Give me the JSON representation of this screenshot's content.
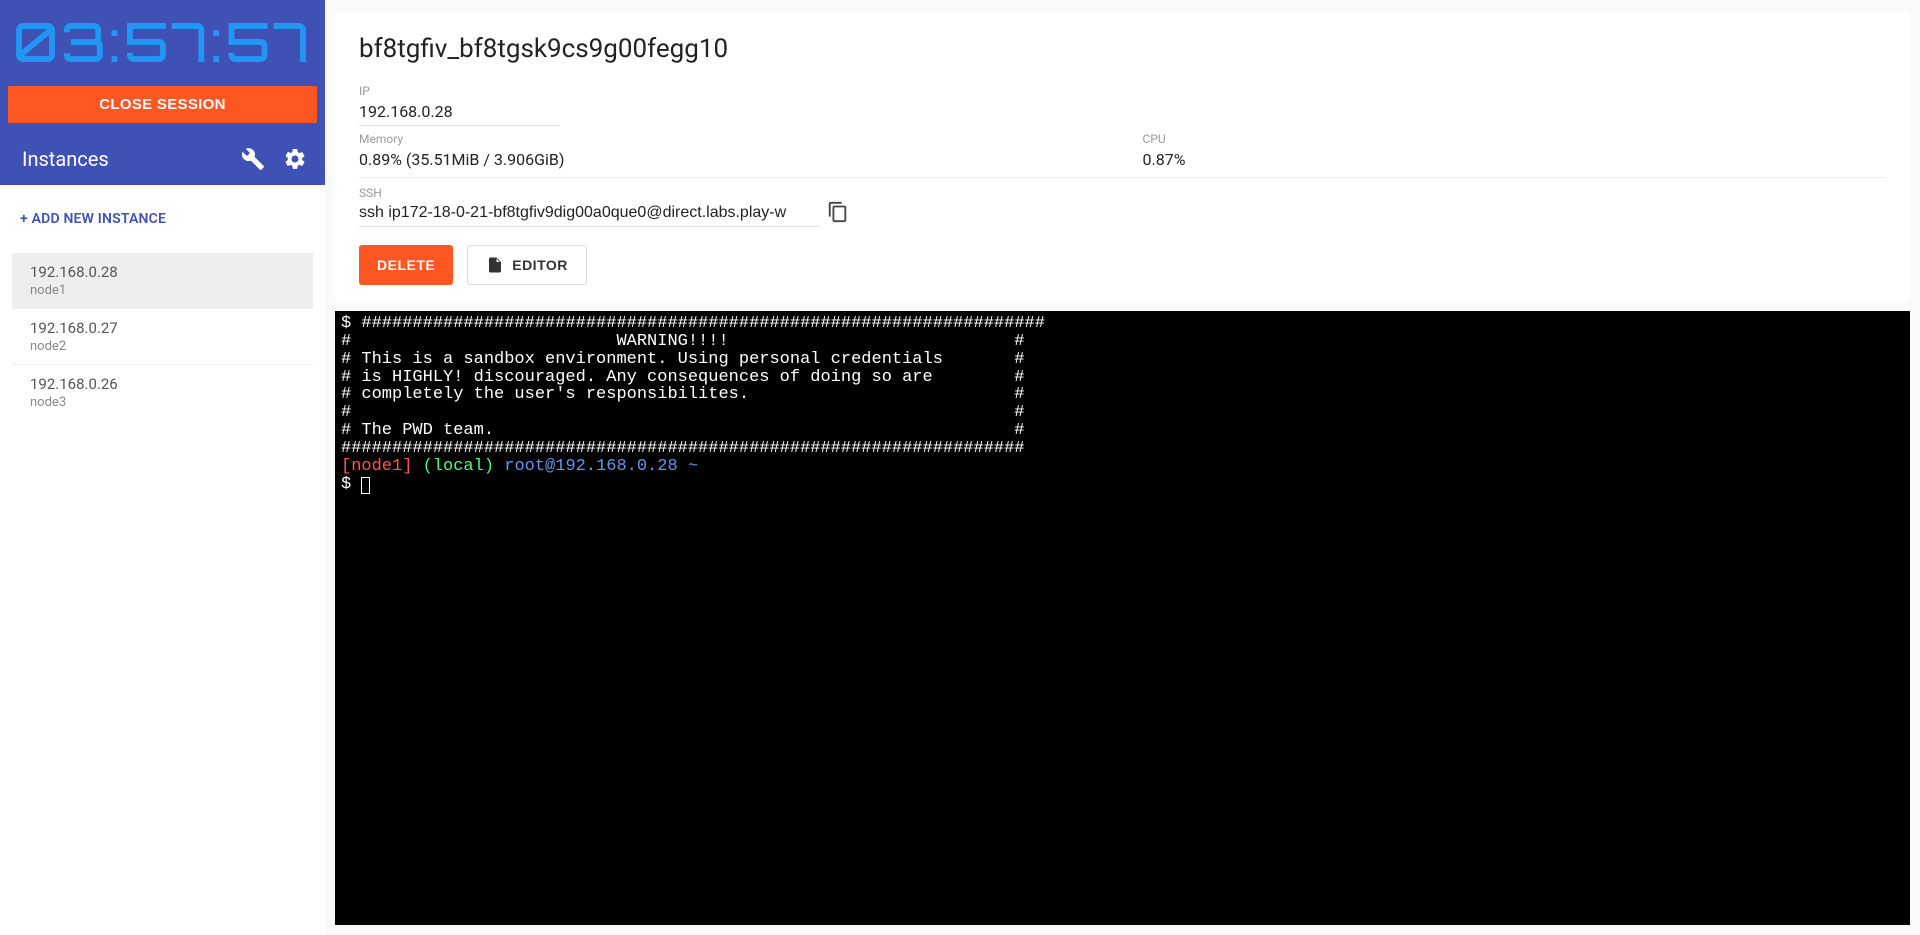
{
  "timer": "03:57:57",
  "close_session_label": "CLOSE SESSION",
  "sidebar": {
    "title": "Instances",
    "add_instance_label": "+ ADD NEW INSTANCE",
    "instances": [
      {
        "ip": "192.168.0.28",
        "name": "node1",
        "selected": true
      },
      {
        "ip": "192.168.0.27",
        "name": "node2",
        "selected": false
      },
      {
        "ip": "192.168.0.26",
        "name": "node3",
        "selected": false
      }
    ]
  },
  "details": {
    "title": "bf8tgfiv_bf8tgsk9cs9g00fegg10",
    "ip_label": "IP",
    "ip_value": "192.168.0.28",
    "memory_label": "Memory",
    "memory_value": "0.89% (35.51MiB / 3.906GiB)",
    "cpu_label": "CPU",
    "cpu_value": "0.87%",
    "ssh_label": "SSH",
    "ssh_value": "ssh ip172-18-0-21-bf8tgfiv9dig00a0que0@direct.labs.play-w",
    "delete_label": "DELETE",
    "editor_label": "EDITOR"
  },
  "terminal": {
    "lines": [
      {
        "segments": [
          {
            "t": "$ ",
            "c": "white"
          },
          {
            "t": "###################################################################",
            "c": "white"
          }
        ]
      },
      {
        "segments": [
          {
            "t": "#                          WARNING!!!!                            #",
            "c": "white"
          }
        ]
      },
      {
        "segments": [
          {
            "t": "# This is a sandbox environment. Using personal credentials       #",
            "c": "white"
          }
        ]
      },
      {
        "segments": [
          {
            "t": "# is HIGHLY! discouraged. Any consequences of doing so are        #",
            "c": "white"
          }
        ]
      },
      {
        "segments": [
          {
            "t": "# completely the user's responsibilites.                          #",
            "c": "white"
          }
        ]
      },
      {
        "segments": [
          {
            "t": "#                                                                 #",
            "c": "white"
          }
        ]
      },
      {
        "segments": [
          {
            "t": "# The PWD team.                                                   #",
            "c": "white"
          }
        ]
      },
      {
        "segments": [
          {
            "t": "###################################################################",
            "c": "white"
          }
        ]
      },
      {
        "segments": [
          {
            "t": "[node1]",
            "c": "red"
          },
          {
            "t": " ",
            "c": "white"
          },
          {
            "t": "(local)",
            "c": "green"
          },
          {
            "t": " ",
            "c": "white"
          },
          {
            "t": "root@192.168.0.28 ~",
            "c": "blue"
          }
        ]
      },
      {
        "segments": [
          {
            "t": "$ ",
            "c": "white"
          }
        ],
        "cursor": true
      }
    ]
  }
}
